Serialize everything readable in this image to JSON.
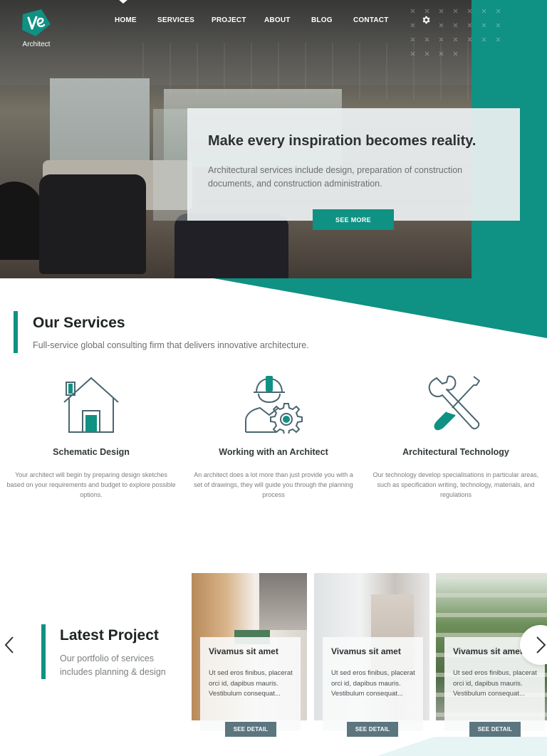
{
  "brand": {
    "name": "Architect",
    "accent": "#0f9183"
  },
  "nav": {
    "items": [
      "HOME",
      "SERVICES",
      "PROJECT",
      "ABOUT",
      "BLOG",
      "CONTACT"
    ],
    "settings_icon": "gear-icon"
  },
  "hero": {
    "title": "Make every inspiration becomes reality.",
    "description": "Architectural services include design, preparation of construction documents, and construction administration.",
    "cta": "SEE MORE"
  },
  "services": {
    "title": "Our Services",
    "subtitle": "Full-service global consulting firm that delivers innovative architecture.",
    "items": [
      {
        "icon": "house-icon",
        "name": "Schematic Design",
        "description": "Your architect will begin by preparing design sketches based on your requirements and budget to explore possible options."
      },
      {
        "icon": "engineer-gear-icon",
        "name": "Working with an Architect",
        "description": "An architect does a lot more than just provide you with a set of drawings, they will guide you through the planning process"
      },
      {
        "icon": "tools-icon",
        "name": "Architectural Technology",
        "description": "Our technology develop specialisations in particular areas, such as specification writing, technology, materials, and regulations"
      }
    ]
  },
  "projects": {
    "title": "Latest Project",
    "subtitle": "Our portfolio of services includes planning & design",
    "items": [
      {
        "name": "Vivamus sit amet",
        "description": "Ut sed eros finibus, placerat orci id, dapibus mauris. Vestibulum consequat...",
        "button": "SEE DETAIL"
      },
      {
        "name": "Vivamus sit amet",
        "description": "Ut sed eros finibus, placerat orci id, dapibus mauris. Vestibulum consequat...",
        "button": "SEE DETAIL"
      },
      {
        "name": "Vivamus sit amet",
        "description": "Ut sed eros finibus, placerat orci id, dapibus mauris. Vestibulum consequat...",
        "button": "SEE DETAIL"
      }
    ],
    "prev_icon": "chevron-left-icon",
    "next_icon": "chevron-right-icon"
  }
}
